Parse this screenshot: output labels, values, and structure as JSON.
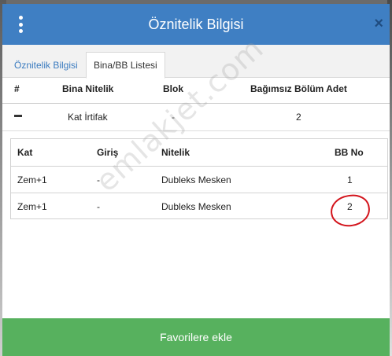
{
  "modal": {
    "title": "Öznitelik Bilgisi",
    "close": "×"
  },
  "tabs": [
    {
      "label": "Öznitelik Bilgisi"
    },
    {
      "label": "Bina/BB Listesi"
    }
  ],
  "outer_table": {
    "headers": [
      "#",
      "Bina Nitelik",
      "Blok",
      "Bağımsız Bölüm Adet"
    ],
    "row": {
      "nitelik": "Kat İrtifak",
      "blok": "-",
      "adet": "2"
    }
  },
  "inner_table": {
    "headers": [
      "Kat",
      "Giriş",
      "Nitelik",
      "BB No"
    ],
    "rows": [
      {
        "kat": "Zem+1",
        "giris": "-",
        "nitelik": "Dubleks Mesken",
        "bb": "1"
      },
      {
        "kat": "Zem+1",
        "giris": "-",
        "nitelik": "Dubleks Mesken",
        "bb": "2"
      }
    ]
  },
  "watermark": "emlakjet.com",
  "footer": {
    "button_label": "Favorilere ekle"
  },
  "colors": {
    "header": "#3f7fc3",
    "button": "#57b15e",
    "annotation": "#d3141c"
  }
}
